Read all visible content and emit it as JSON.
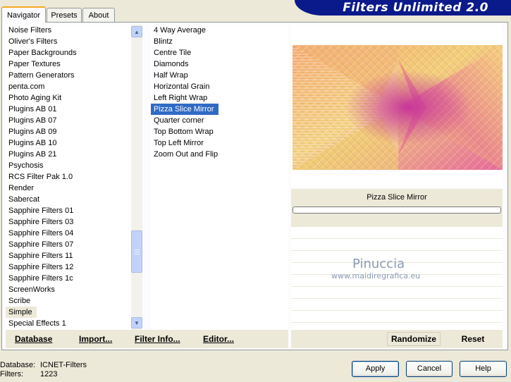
{
  "app": {
    "title": "Filters Unlimited 2.0"
  },
  "tabs": [
    {
      "label": "Navigator",
      "active": true
    },
    {
      "label": "Presets",
      "active": false
    },
    {
      "label": "About",
      "active": false
    }
  ],
  "categories": {
    "items": [
      "Noise Filters",
      "Oliver's Filters",
      "Paper Backgrounds",
      "Paper Textures",
      "Pattern Generators",
      "penta.com",
      "Photo Aging Kit",
      "Plugins AB 01",
      "Plugins AB 07",
      "Plugins AB 09",
      "Plugins AB 10",
      "Plugins AB 21",
      "Psychosis",
      "RCS Filter Pak 1.0",
      "Render",
      "Sabercat",
      "Sapphire Filters 01",
      "Sapphire Filters 03",
      "Sapphire Filters 04",
      "Sapphire Filters 07",
      "Sapphire Filters 11",
      "Sapphire Filters 12",
      "Sapphire Filters 1c",
      "ScreenWorks",
      "Scribe",
      "Simple",
      "Special Effects 1"
    ],
    "selected": "Simple"
  },
  "filters": {
    "items": [
      "4 Way Average",
      "Blintz",
      "Centre Tile",
      "Diamonds",
      "Half Wrap",
      "Horizontal Grain",
      "Left Right Wrap",
      "Pizza Slice Mirror",
      "Quarter corner",
      "Top Bottom Wrap",
      "Top Left Mirror",
      "Zoom Out and Flip"
    ],
    "selected": "Pizza Slice Mirror"
  },
  "bottom_bar": {
    "database_label": "Database",
    "import_label": "Import...",
    "filter_info_label": "Filter Info...",
    "editor_label": "Editor..."
  },
  "preview": {
    "filter_name": "Pizza Slice Mirror",
    "watermark_name": "Pinuccia",
    "watermark_url": "www.maidiregrafica.eu"
  },
  "right_bar": {
    "randomize_label": "Randomize",
    "reset_label": "Reset"
  },
  "status": {
    "database_key": "Database:",
    "database_value": "ICNET-Filters",
    "filters_key": "Filters:",
    "filters_value": "1223"
  },
  "dialog_buttons": {
    "apply": "Apply",
    "cancel": "Cancel",
    "help": "Help"
  },
  "colors": {
    "banner": "#0a1a8a",
    "selection": "#316ac5",
    "tab_accent": "#f5a623"
  }
}
